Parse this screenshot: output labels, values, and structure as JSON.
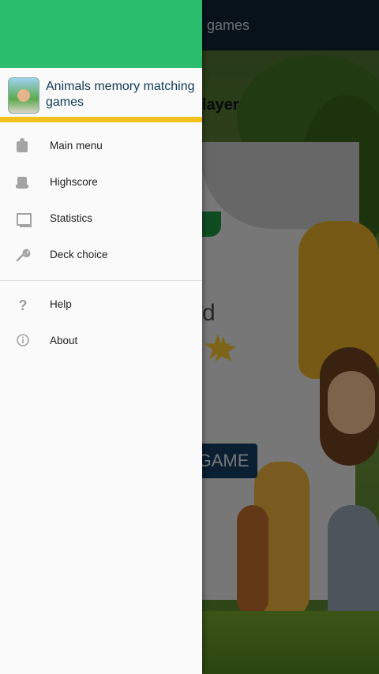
{
  "background_app": {
    "toolbar_title": "games",
    "player_text": "layer",
    "partial_text": "d",
    "game_button_label": "GAME"
  },
  "drawer": {
    "app_name": "Animals memory matching games",
    "accent_color": "#2abd6e",
    "underline_color": "#f1c21b",
    "primary_items": [
      {
        "label": "Main menu",
        "icon": "puzzle-icon"
      },
      {
        "label": "Highscore",
        "icon": "trophy-icon"
      },
      {
        "label": "Statistics",
        "icon": "monitor-icon"
      },
      {
        "label": "Deck choice",
        "icon": "wrench-icon"
      }
    ],
    "secondary_items": [
      {
        "label": "Help",
        "icon": "question-icon"
      },
      {
        "label": "About",
        "icon": "info-icon"
      }
    ]
  }
}
